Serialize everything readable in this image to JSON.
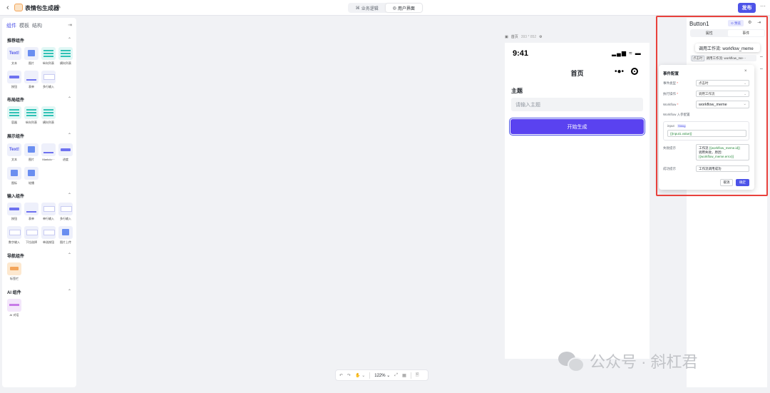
{
  "topbar": {
    "back": "‹",
    "title": "表情包生成器",
    "mode_tabs": [
      "业务逻辑",
      "用户界面"
    ],
    "publish": "发布",
    "more": "···"
  },
  "left_panel": {
    "tabs": [
      "组件",
      "模板",
      "结构"
    ],
    "sections": {
      "recommended": "推荐组件",
      "layout": "布局组件",
      "display": "展示组件",
      "input": "输入组件",
      "nav": "导航组件",
      "ai": "AI 组件"
    },
    "recommended_items": [
      "文本",
      "图片",
      "纵向列表",
      "横向列表",
      "按钮",
      "表单",
      "多行输入"
    ],
    "layout_items": [
      "容器",
      "纵向列表",
      "横向列表"
    ],
    "display_items": [
      "文本",
      "图片",
      "Markdo···",
      "进度",
      "图标",
      "轮播"
    ],
    "input_items": [
      "按钮",
      "表单",
      "单行输入",
      "多行输入",
      "数字输入",
      "下拉选择",
      "单选按钮",
      "图片上传"
    ],
    "nav_items": [
      "标签栏"
    ],
    "ai_items": [
      "AI 对话"
    ],
    "text_thumb": "Text!",
    "nav_thumb": "标签"
  },
  "canvas": {
    "page_label": "首页",
    "page_size": "393 * 852",
    "time": "9:41",
    "status_icons": "▂▄▆ ≈ ▬",
    "nav_title": "首页",
    "menu_icon": "•●•",
    "field_label": "主题",
    "input_placeholder": "请输入主题",
    "button_label": "开始生成"
  },
  "toolbar": {
    "undo": "↶",
    "redo": "↷",
    "hand": "✋ ⌄",
    "zoom": "122% ⌄",
    "fit": "⤢",
    "grid": "▦",
    "doc": "🗎"
  },
  "right_panel": {
    "component_name": "Button1",
    "preview": "⊙ 预览",
    "tabs": [
      "属性",
      "事件"
    ],
    "tooltip": "调用工作流: workflow_meme",
    "event_tag": "点击时",
    "event_text": "调用工作流: workflow_me···"
  },
  "modal": {
    "title": "事件配置",
    "close": "×",
    "event_type_label": "事件类型",
    "event_type_value": "点击时",
    "action_label": "执行操作",
    "action_value": "调用工作流",
    "workflow_label": "Workflow",
    "workflow_value": "workflow_meme",
    "param_section": "Workflow 入参配置",
    "param_name": "input",
    "param_type": "String",
    "param_expr": "{{Input1.value}}",
    "fail_label": "失败提示",
    "fail_text_1": "工作流",
    "fail_code_1": "{{workflow_meme.id}}",
    "fail_text_2": "调用失败，原因:",
    "fail_code_2": "{{workflow_meme.error}}",
    "success_label": "成功提示",
    "success_value": "工作流调用成功",
    "cancel": "取消",
    "confirm": "确定"
  },
  "watermark": "公众号 · 斜杠君",
  "colors": {
    "accent": "#4d53e8",
    "button": "#5a42f0",
    "highlight": "#e8413c"
  }
}
